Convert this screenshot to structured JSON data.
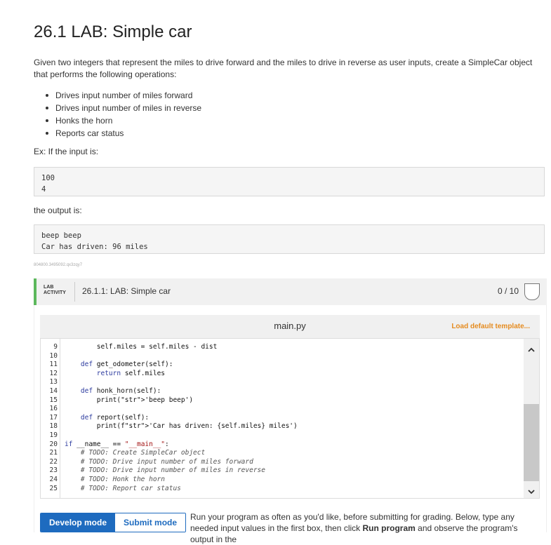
{
  "title": "26.1 LAB: Simple car",
  "description": "Given two integers that represent the miles to drive forward and the miles to drive in reverse as user inputs, create a SimpleCar object that performs the following operations:",
  "operations": [
    "Drives input number of miles forward",
    "Drives input number of miles in reverse",
    "Honks the horn",
    "Reports car status"
  ],
  "example_intro": "Ex: If the input is:",
  "example_input": "100\n4",
  "output_intro": "the output is:",
  "example_output": "beep beep\nCar has driven: 96 miles",
  "content_id": "804800.3495092.qx3zqy7",
  "lab": {
    "tag_line1": "LAB",
    "tag_line2": "ACTIVITY",
    "name": "26.1.1: LAB: Simple car",
    "score": "0 / 10"
  },
  "editor": {
    "file_name": "main.py",
    "load_default": "Load default template...",
    "line_numbers": [
      "9",
      "10",
      "11",
      "12",
      "13",
      "14",
      "15",
      "16",
      "17",
      "18",
      "19",
      "20",
      "21",
      "22",
      "23",
      "24",
      "25"
    ],
    "lines": [
      "        self.miles = self.miles - dist",
      "",
      "    def get_odometer(self):",
      "        return self.miles",
      "",
      "    def honk_horn(self):",
      "        print('beep beep')",
      "",
      "    def report(self):",
      "        print(f'Car has driven: {self.miles} miles')",
      "",
      "if __name__ == \"__main__\":",
      "    # TODO: Create SimpleCar object",
      "    # TODO: Drive input number of miles forward",
      "    # TODO: Drive input number of miles in reverse",
      "    # TODO: Honk the horn",
      "    # TODO: Report car status"
    ]
  },
  "buttons": {
    "develop_mode": "Develop mode",
    "submit_mode": "Submit mode"
  },
  "run_info_parts": {
    "before": "Run your program as often as you'd like, before submitting for grading. Below, type any needed input values in the first box, then click ",
    "run_program": "Run program",
    "after": " and observe the program's output in the"
  },
  "colors": {
    "accent_blue": "#1e6bbf",
    "lab_green": "#5cb85c",
    "load_orange": "#e58b1f"
  }
}
